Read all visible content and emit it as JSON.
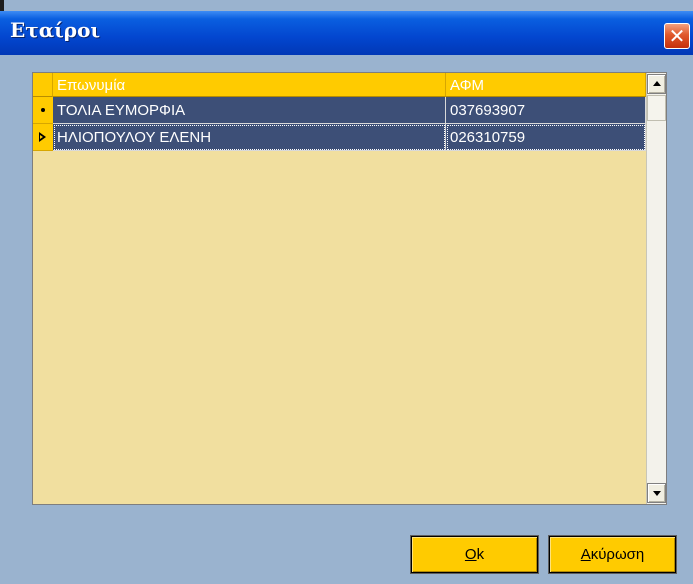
{
  "window": {
    "title": "Εταίροι",
    "close_glyph": "✕"
  },
  "grid": {
    "columns": [
      "Επωνυμία",
      "ΑΦΜ"
    ],
    "rows": [
      {
        "name": "ΤΟΛΙΑ ΕΥΜΟΡΦΙΑ",
        "afm": "037693907",
        "indicator": "dot-icon"
      },
      {
        "name": "ΗΛΙΟΠΟΥΛΟΥ ΕΛΕΝΗ",
        "afm": "026310759",
        "indicator": "current-row-arrow-icon"
      }
    ]
  },
  "buttons": {
    "ok_first": "O",
    "ok_rest": "k",
    "cancel_first": "Α",
    "cancel_rest": "κύρωση"
  },
  "colors": {
    "header": "#ffcb00",
    "grid_background": "#f1df9f",
    "selected_row": "#3d4f77",
    "title_bar": "#0346cf",
    "dialog_background": "#9ab3cf"
  }
}
